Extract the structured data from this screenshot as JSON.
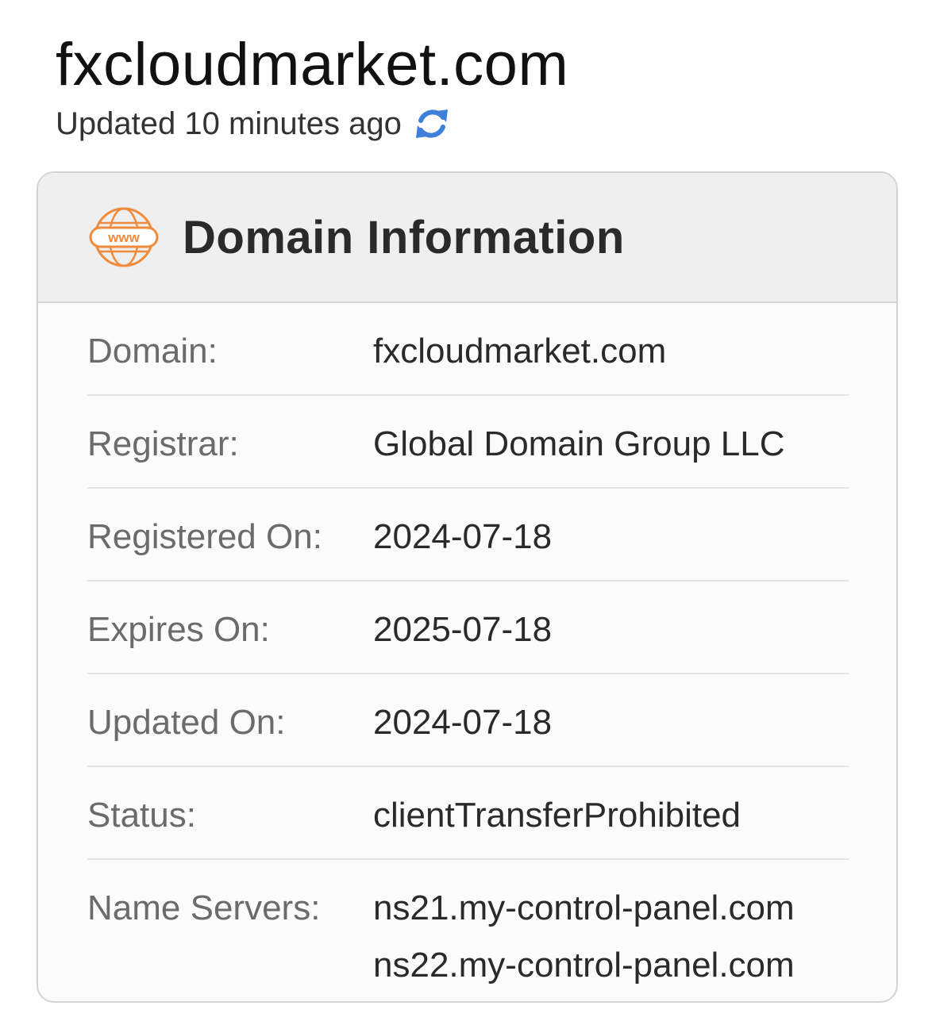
{
  "header": {
    "title": "fxcloudmarket.com",
    "updated_text": "Updated 10 minutes ago",
    "refresh_icon": "refresh-icon",
    "refresh_color": "#3d7fd9"
  },
  "card": {
    "icon": "www-globe-icon",
    "icon_color": "#f08a3c",
    "title": "Domain Information",
    "rows": [
      {
        "label": "Domain:",
        "value": "fxcloudmarket.com"
      },
      {
        "label": "Registrar:",
        "value": "Global Domain Group LLC"
      },
      {
        "label": "Registered On:",
        "value": "2024-07-18"
      },
      {
        "label": "Expires On:",
        "value": "2025-07-18"
      },
      {
        "label": "Updated On:",
        "value": "2024-07-18"
      },
      {
        "label": "Status:",
        "value": "clientTransferProhibited"
      },
      {
        "label": "Name Servers:",
        "values": [
          "ns21.my-control-panel.com",
          "ns22.my-control-panel.com"
        ]
      }
    ]
  }
}
